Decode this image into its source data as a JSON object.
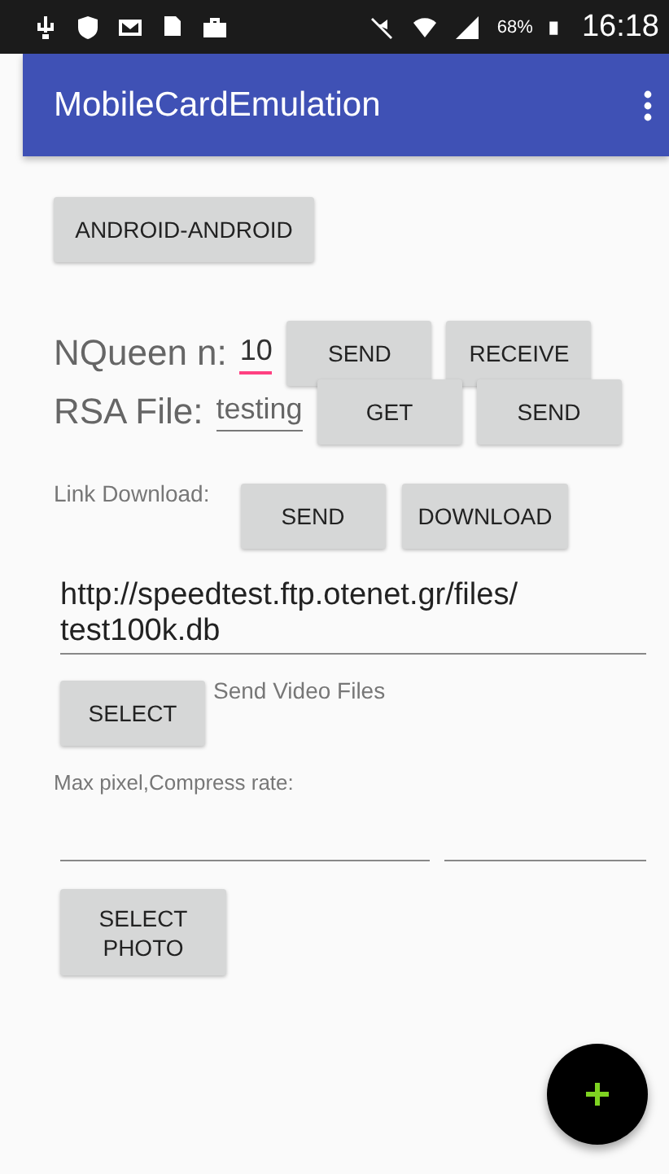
{
  "status_bar": {
    "battery": "68%",
    "time": "16:18"
  },
  "app_bar": {
    "title": "MobileCardEmulation"
  },
  "mode_button": "ANDROID-ANDROID",
  "rows": [
    {
      "label": "NQueen n:",
      "value": "10",
      "focused": true,
      "buttons": [
        "SEND",
        "RECEIVE"
      ]
    },
    {
      "label": "RSA File:",
      "value": "testing",
      "focused": false,
      "buttons": [
        "GET",
        "SEND"
      ]
    }
  ],
  "link": {
    "label": "Link Download:",
    "buttons": [
      "SEND",
      "DOWNLOAD"
    ],
    "url": "http://speedtest.ftp.otenet.gr/files/test100k.db"
  },
  "video": {
    "button": "SELECT",
    "label": "Send Video Files"
  },
  "compress": {
    "label": "Max pixel,Compress rate:"
  },
  "photo_button": "SELECT PHOTO"
}
